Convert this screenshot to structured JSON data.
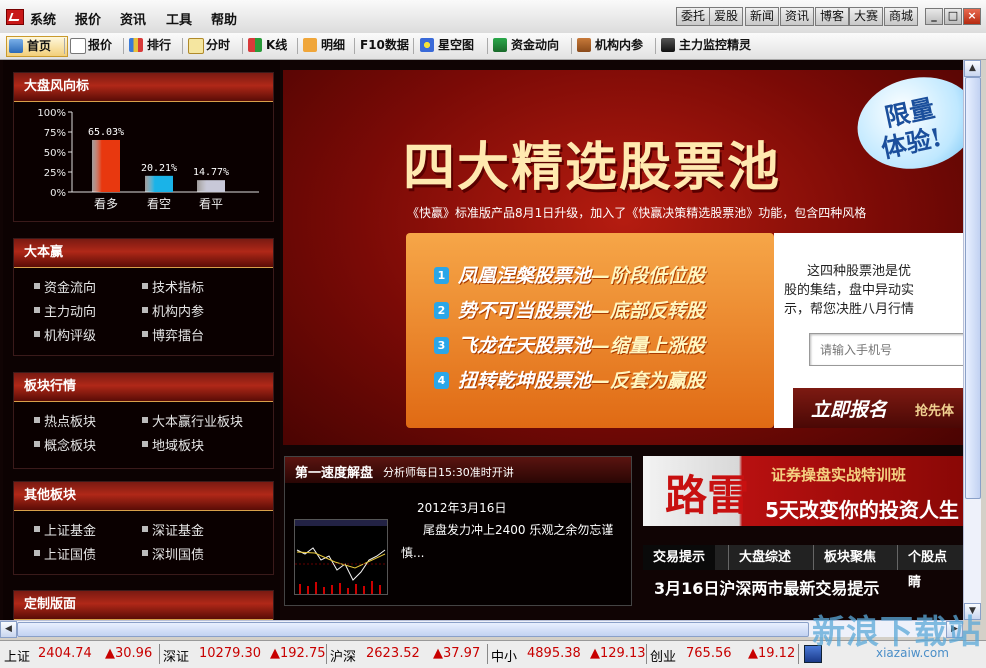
{
  "menubar": {
    "items": [
      "系统",
      "报价",
      "资讯",
      "工具",
      "帮助"
    ],
    "right_buttons": [
      "委托",
      "爱股",
      "新闻",
      "资讯",
      "博客",
      "大赛",
      "商城"
    ]
  },
  "toolbar": {
    "items": [
      {
        "label": "首页",
        "icon": "home-icon"
      },
      {
        "label": "报价",
        "icon": "grid-icon"
      },
      {
        "label": "排行",
        "icon": "ranking-icon"
      },
      {
        "label": "分时",
        "icon": "timeshare-icon"
      },
      {
        "label": "K线",
        "icon": "kline-icon"
      },
      {
        "label": "明细",
        "icon": "detail-icon"
      },
      {
        "label": "F10数据",
        "icon": "f10-icon"
      },
      {
        "label": "星空图",
        "icon": "starmap-icon"
      },
      {
        "label": "资金动向",
        "icon": "money-flow-icon"
      },
      {
        "label": "机构内参",
        "icon": "institution-icon"
      },
      {
        "label": "主力监控精灵",
        "icon": "monitor-icon"
      }
    ]
  },
  "market_wind": {
    "title": "大盘风向标",
    "chart_data": {
      "type": "bar",
      "categories": [
        "看多",
        "看空",
        "看平"
      ],
      "values": [
        65.03,
        20.21,
        14.77
      ],
      "value_labels": [
        "65.03%",
        "20.21%",
        "14.77%"
      ],
      "y_ticks": [
        "100%",
        "75%",
        "50%",
        "25%",
        "0%"
      ],
      "ylim": [
        0,
        100
      ],
      "colors": [
        "#e8380f",
        "#1ab3e8",
        "#c8c8d8"
      ]
    }
  },
  "dabenying": {
    "title": "大本赢",
    "links": [
      "资金流向",
      "技术指标",
      "主力动向",
      "机构内参",
      "机构评级",
      "博弈擂台"
    ]
  },
  "sector_quotes": {
    "title": "板块行情",
    "links": [
      "热点板块",
      "大本赢行业板块",
      "概念板块",
      "地域板块"
    ]
  },
  "other_sectors": {
    "title": "其他板块",
    "links": [
      "上证基金",
      "深证基金",
      "上证国债",
      "深圳国债"
    ]
  },
  "custom_layout": {
    "title": "定制版面"
  },
  "banner": {
    "title": "四大精选股票池",
    "bubble_line1": "限量",
    "bubble_line2": "体验!",
    "subtitle": "《快赢》标准版产品8月1日升级，加入了《快赢决策精选股票池》功能，包含四种风格",
    "pools": [
      {
        "num": "1",
        "name": "凤凰涅槃股票池",
        "suffix": "—阶段低位股"
      },
      {
        "num": "2",
        "name": "势不可当股票池",
        "suffix": "—底部反转股"
      },
      {
        "num": "3",
        "name": "飞龙在天股票池",
        "suffix": "—缩量上涨股"
      },
      {
        "num": "4",
        "name": "扭转乾坤股票池",
        "suffix": "—反套为赢股"
      }
    ],
    "side_text": [
      "这四种股票池是优",
      "股的集结，盘中异动实",
      "示，帮您决胜八月行情"
    ],
    "phone_placeholder": "请输入手机号",
    "signup": "立即报名",
    "signup_sub": "抢先体"
  },
  "live": {
    "title": "第一速度解盘",
    "subtitle": "分析师每日15:30准时开讲",
    "date": "2012年3月16日",
    "headline": "尾盘发力冲上2400 乐观之余勿忘谨",
    "headline_cont": "慎..."
  },
  "ad_lu": {
    "brand": "路雷",
    "line1": "证券操盘实战特训班",
    "line2": "5天改变你的投资人生"
  },
  "news_tabs": {
    "tabs": [
      "交易提示",
      "大盘综述",
      "板块聚焦",
      "个股点睛"
    ],
    "headline": "3月16日沪深两市最新交易提示"
  },
  "status": {
    "markets": [
      {
        "name": "上证",
        "value": "2404.74",
        "change": "▲30.96"
      },
      {
        "name": "深证",
        "value": "10279.30",
        "change": "▲192.75"
      },
      {
        "name": "沪深",
        "value": "2623.52",
        "change": "▲37.97"
      },
      {
        "name": "中小",
        "value": "4895.38",
        "change": "▲129.13"
      },
      {
        "name": "创业",
        "value": "765.56",
        "change": "▲19.12"
      }
    ]
  },
  "watermark": {
    "text": "新浪下载站",
    "url": "xiazaiw.com"
  }
}
